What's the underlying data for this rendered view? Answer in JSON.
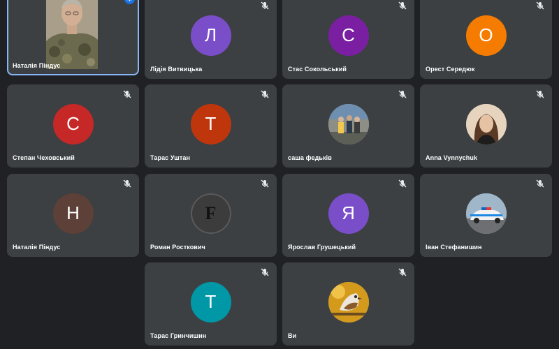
{
  "participants": [
    {
      "name": "Наталія Піндус",
      "type": "video",
      "muted": false,
      "speaking": true
    },
    {
      "name": "Лідія Витвицька",
      "type": "initial",
      "initial": "Л",
      "color": "#7b4ec9",
      "muted": true
    },
    {
      "name": "Стас Сокольський",
      "type": "initial",
      "initial": "С",
      "color": "#7b1fa2",
      "muted": true
    },
    {
      "name": "Орест Середюк",
      "type": "initial",
      "initial": "О",
      "color": "#f57c00",
      "muted": true
    },
    {
      "name": "Степан Чеховський",
      "type": "initial",
      "initial": "С",
      "color": "#c62828",
      "muted": true
    },
    {
      "name": "Тарас Уштан",
      "type": "initial",
      "initial": "Т",
      "color": "#bf360c",
      "muted": true
    },
    {
      "name": "саша федьків",
      "type": "photo",
      "icon": "group-photo",
      "muted": true
    },
    {
      "name": "Anna Vynnychuk",
      "type": "photo",
      "icon": "woman-portrait-photo",
      "muted": true
    },
    {
      "name": "Наталія Піндус",
      "type": "initial",
      "initial": "Н",
      "color": "#5d4037",
      "muted": true
    },
    {
      "name": "Роман Росткович",
      "type": "initial",
      "initial": "F",
      "color": "#3c3c3c",
      "muted": true
    },
    {
      "name": "Ярослав Грушецький",
      "type": "initial",
      "initial": "Я",
      "color": "#7b4ec9",
      "muted": true
    },
    {
      "name": "Іван Стефанишин",
      "type": "photo",
      "icon": "police-car-photo",
      "muted": true
    },
    {
      "name": "Тарас Гринчишин",
      "type": "initial",
      "initial": "Т",
      "color": "#0097a7",
      "muted": true
    },
    {
      "name": "Ви",
      "type": "photo",
      "icon": "bird-photo",
      "muted": true
    }
  ],
  "colors": {
    "background": "#202124",
    "tile": "#3c4043",
    "active_outline": "#8ab4f8",
    "speaking_indicator": "#1a73e8"
  }
}
